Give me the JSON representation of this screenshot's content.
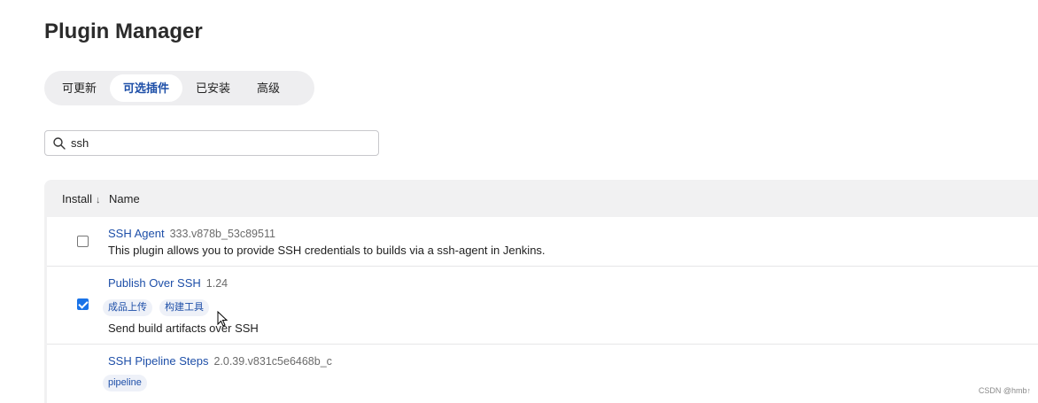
{
  "page": {
    "title": "Plugin Manager"
  },
  "tabs": [
    {
      "label": "可更新",
      "active": false
    },
    {
      "label": "可选插件",
      "active": true
    },
    {
      "label": "已安装",
      "active": false
    },
    {
      "label": "高级",
      "active": false
    }
  ],
  "search": {
    "value": "ssh",
    "icon": "search-icon"
  },
  "table": {
    "headers": {
      "install": "Install",
      "sort_indicator": "↓",
      "name": "Name"
    },
    "rows": [
      {
        "name": "SSH Agent",
        "version": "333.v878b_53c89511",
        "checked": false,
        "tags": [],
        "description": "This plugin allows you to provide SSH credentials to builds via a ssh-agent in Jenkins."
      },
      {
        "name": "Publish Over SSH",
        "version": "1.24",
        "checked": true,
        "tags": [
          "成品上传",
          "构建工具"
        ],
        "description": "Send build artifacts over SSH"
      },
      {
        "name": "SSH Pipeline Steps",
        "version": "2.0.39.v831c5e6468b_c",
        "checked": false,
        "tags": [
          "pipeline"
        ],
        "description": ""
      }
    ]
  },
  "watermark": "CSDN @hmb↑",
  "colors": {
    "link": "#1e4fa8",
    "checkbox_checked": "#1a73e8",
    "tab_bg": "#eeeef0"
  }
}
